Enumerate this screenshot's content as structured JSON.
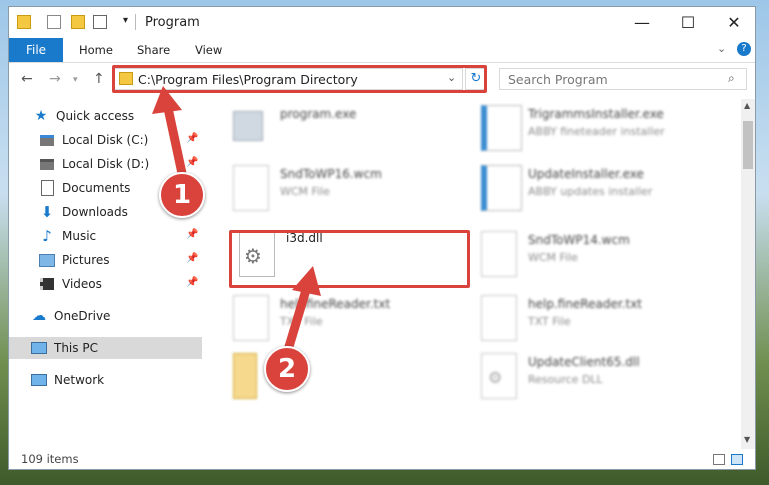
{
  "window": {
    "title": "Program",
    "controls": {
      "minimize": "—",
      "maximize": "☐",
      "close": "✕"
    }
  },
  "ribbon": {
    "tabs": [
      "File",
      "Home",
      "Share",
      "View"
    ],
    "help_icon": "?"
  },
  "address": {
    "path": "C:\\Program Files\\Program Directory",
    "search_placeholder": "Search Program"
  },
  "nav_pane": {
    "items": [
      {
        "label": "Quick access",
        "icon": "star-icon",
        "pinned": false,
        "selected": false
      },
      {
        "label": "Local Disk (C:)",
        "icon": "drive-icon",
        "pinned": true,
        "selected": false
      },
      {
        "label": "Local Disk (D:)",
        "icon": "drive-icon",
        "pinned": true,
        "selected": false
      },
      {
        "label": "Documents",
        "icon": "documents-icon",
        "pinned": true,
        "selected": false
      },
      {
        "label": "Downloads",
        "icon": "downloads-icon",
        "pinned": true,
        "selected": false
      },
      {
        "label": "Music",
        "icon": "music-icon",
        "pinned": true,
        "selected": false
      },
      {
        "label": "Pictures",
        "icon": "pictures-icon",
        "pinned": true,
        "selected": false
      },
      {
        "label": "Videos",
        "icon": "videos-icon",
        "pinned": true,
        "selected": false
      },
      {
        "label": "OneDrive",
        "icon": "onedrive-icon",
        "pinned": false,
        "selected": false
      },
      {
        "label": "This PC",
        "icon": "pc-icon",
        "pinned": false,
        "selected": true
      },
      {
        "label": "Network",
        "icon": "network-icon",
        "pinned": false,
        "selected": false
      }
    ]
  },
  "files": [
    {
      "name": "program.exe",
      "type": "",
      "icon": "exe-icon"
    },
    {
      "name": "TrigrammsInstaller.exe",
      "type": "ABBY fineteader installer",
      "icon": "installer-icon"
    },
    {
      "name": "SndToWP16.wcm",
      "type": "WCM File",
      "icon": "blank-file-icon"
    },
    {
      "name": "UpdateInstaller.exe",
      "type": "ABBY updates installer",
      "icon": "installer-icon"
    },
    {
      "name": "i3d.dll",
      "type": "",
      "icon": "dll-gear-icon"
    },
    {
      "name": "SndToWP14.wcm",
      "type": "WCM File",
      "icon": "blank-file-icon"
    },
    {
      "name": "helpfineReader.txt",
      "type": "TXT File",
      "icon": "blank-file-icon"
    },
    {
      "name": "help.fineReader.txt",
      "type": "TXT File",
      "icon": "blank-file-icon"
    },
    {
      "name": "",
      "type": "",
      "icon": "folder-file-icon"
    },
    {
      "name": "UpdateClient65.dll",
      "type": "Resource DLL",
      "icon": "dll-gear-icon"
    }
  ],
  "status": {
    "item_count": "109 items"
  },
  "annotations": {
    "step1": "1",
    "step2": "2",
    "color": "#d9433c"
  }
}
